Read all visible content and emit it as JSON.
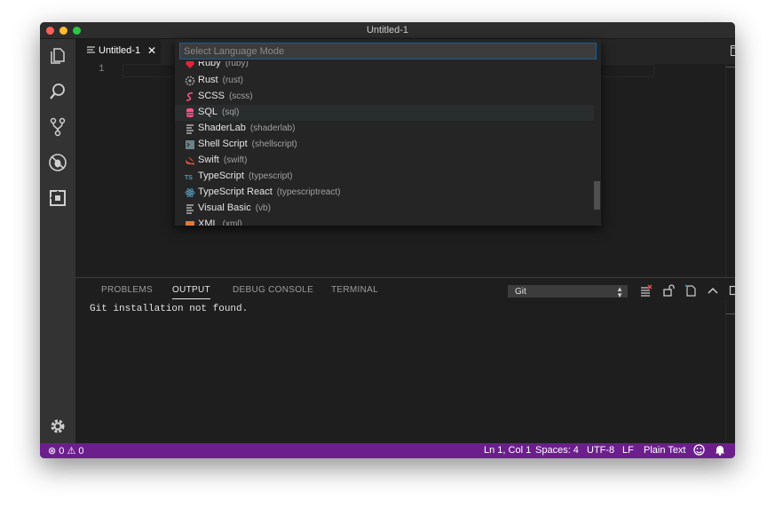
{
  "window": {
    "title": "Untitled-1"
  },
  "editor": {
    "tab_label": "Untitled-1",
    "tab_close": "✕",
    "line_number": "1",
    "more_label": "•••"
  },
  "quick_pick": {
    "placeholder": "Select Language Mode",
    "items": [
      {
        "label": "Ruby",
        "id": "(ruby)",
        "icon": "ruby-icon",
        "color": "#e0243a"
      },
      {
        "label": "Rust",
        "id": "(rust)",
        "icon": "rust-icon",
        "color": "#9a9a9a"
      },
      {
        "label": "SCSS",
        "id": "(scss)",
        "icon": "scss-icon",
        "color": "#f55385"
      },
      {
        "label": "SQL",
        "id": "(sql)",
        "icon": "sql-icon",
        "color": "#f55385"
      },
      {
        "label": "ShaderLab",
        "id": "(shaderlab)",
        "icon": "file-lines-icon",
        "color": "#cccccc"
      },
      {
        "label": "Shell Script",
        "id": "(shellscript)",
        "icon": "terminal-icon",
        "color": "#6d8086"
      },
      {
        "label": "Swift",
        "id": "(swift)",
        "icon": "swift-icon",
        "color": "#f05138"
      },
      {
        "label": "TypeScript",
        "id": "(typescript)",
        "icon": "typescript-icon",
        "color": "#519aba"
      },
      {
        "label": "TypeScript React",
        "id": "(typescriptreact)",
        "icon": "react-icon",
        "color": "#519aba"
      },
      {
        "label": "Visual Basic",
        "id": "(vb)",
        "icon": "file-lines-icon",
        "color": "#cccccc"
      },
      {
        "label": "XML",
        "id": "(xml)",
        "icon": "xml-icon",
        "color": "#e37933"
      }
    ]
  },
  "panel": {
    "tabs": [
      "PROBLEMS",
      "OUTPUT",
      "DEBUG CONSOLE",
      "TERMINAL"
    ],
    "active_tab": "OUTPUT",
    "output_channel": "Git",
    "output_channel_arrows": "⌃⌄",
    "output_text": "Git installation not found.",
    "close_label": "✕"
  },
  "status": {
    "errors": "0",
    "warnings": "0",
    "position": "Ln 1, Col 1",
    "spaces": "Spaces: 4",
    "encoding": "UTF-8",
    "eol": "LF",
    "language": "Plain Text"
  },
  "colors": {
    "status_bar": "#6c1f8c",
    "accent": "#0e639c"
  }
}
